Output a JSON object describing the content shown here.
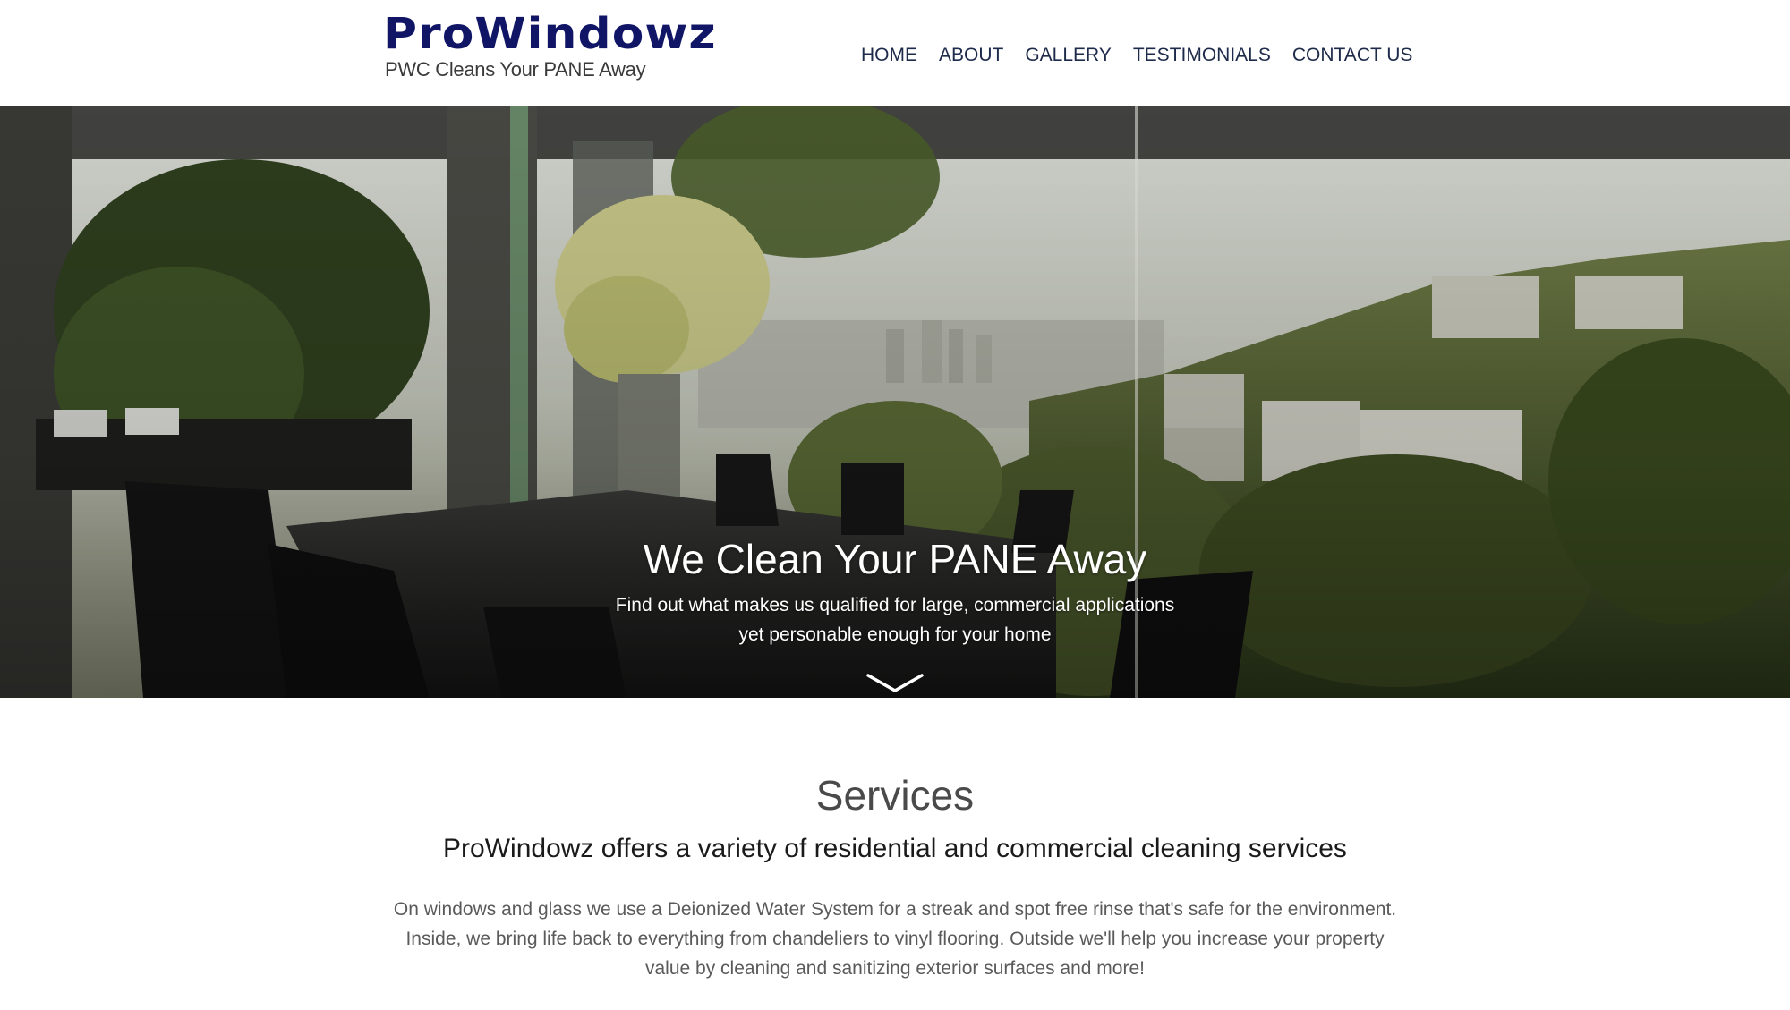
{
  "header": {
    "logo": {
      "title": "ProWindowz",
      "tagline": "PWC Cleans Your PANE Away",
      "color": "#101566"
    },
    "nav": [
      {
        "label": "HOME"
      },
      {
        "label": "ABOUT"
      },
      {
        "label": "GALLERY"
      },
      {
        "label": "TESTIMONIALS"
      },
      {
        "label": "CONTACT US"
      }
    ]
  },
  "hero": {
    "title": "We Clean Your PANE Away",
    "subtitle_line1": "Find out what makes us qualified for large, commercial applications",
    "subtitle_line2": "yet personable enough for your home",
    "scroll_icon": "chevron-down-icon"
  },
  "services": {
    "heading": "Services",
    "subheading": "ProWindowz offers a variety of residential and commercial cleaning services",
    "text_line1": "On windows and glass we use a Deionized Water System for a streak and spot free rinse that's safe for the environment.",
    "text_line2": "Inside, we bring life back to everything from chandeliers to vinyl flooring. Outside we'll help you increase your property",
    "text_line3": "value by cleaning and sanitizing exterior surfaces and more!"
  }
}
